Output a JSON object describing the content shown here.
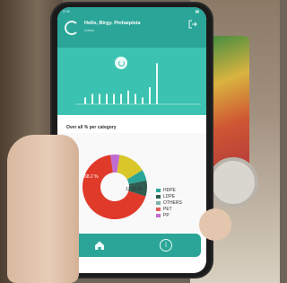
{
  "status_bar": {
    "time": "3:33",
    "battery": "▮▮"
  },
  "header": {
    "greeting": "Hello, Birgy. Pinhaipleta",
    "subtitle": "Admin",
    "logout_icon": "logout-icon"
  },
  "top_chart": {
    "bar_values": [
      2,
      3,
      3,
      3,
      3,
      3,
      4,
      3,
      2,
      5,
      12
    ]
  },
  "breakdown": {
    "title": "Over all % per category",
    "donut_label_left": "68.2 %",
    "donut_label_right": "13.95 %",
    "chart_data": {
      "type": "pie",
      "title": "Over all % per category",
      "categories": [
        "HDPE",
        "LDPE",
        "OTHERS",
        "PET",
        "PP"
      ],
      "values": [
        13.95,
        5.5,
        7.85,
        68.2,
        4.5
      ],
      "colors": [
        "#d9c72a",
        "#2aa597",
        "#2f5d50",
        "#e03a2a",
        "#c06bd0"
      ]
    },
    "legend": [
      {
        "label": "HDPE",
        "color": "#2aa597"
      },
      {
        "label": "LDPE",
        "color": "#2f5d50"
      },
      {
        "label": "OTHERS",
        "color": "#7fb3a8"
      },
      {
        "label": "PET",
        "color": "#e05d5d"
      },
      {
        "label": "PP",
        "color": "#c06bd0"
      }
    ]
  },
  "tabbar": {
    "home_icon": "home-icon",
    "info_icon": "info-icon",
    "info_glyph": "i"
  }
}
